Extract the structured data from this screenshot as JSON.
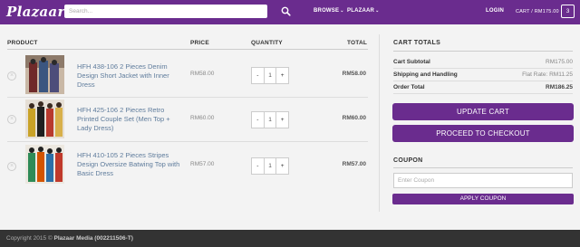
{
  "header": {
    "logo": "Plazaar",
    "search_placeholder": "Search...",
    "nav": [
      {
        "label": "BROWSE"
      },
      {
        "label": "PLAZAAR"
      }
    ],
    "login": "LOGIN",
    "cart_label": "CART / RM175.00",
    "cart_count": "3"
  },
  "table": {
    "headers": {
      "product": "PRODUCT",
      "price": "PRICE",
      "quantity": "QUANTITY",
      "total": "TOTAL"
    },
    "rows": [
      {
        "name": "HFH 438-106 2 Pieces Denim Design Short Jacket with Inner Dress",
        "price": "RM58.00",
        "qty": "1",
        "total": "RM58.00"
      },
      {
        "name": "HFH 425-106 2 Pieces Retro Printed Couple Set (Men Top + Lady Dress)",
        "price": "RM60.00",
        "qty": "1",
        "total": "RM60.00"
      },
      {
        "name": "HFH 410-105 2 Pieces Stripes Design Oversize Batwing Top with Basic Dress",
        "price": "RM57.00",
        "qty": "1",
        "total": "RM57.00"
      }
    ],
    "qty_minus": "-",
    "qty_plus": "+",
    "remove_symbol": "×"
  },
  "totals": {
    "title": "CART TOTALS",
    "subtotal_label": "Cart Subtotal",
    "subtotal_value": "RM175.00",
    "shipping_label": "Shipping and Handling",
    "shipping_value": "Flat Rate: RM11.25",
    "order_label": "Order Total",
    "order_value": "RM186.25",
    "update_button": "UPDATE CART",
    "checkout_button": "PROCEED TO CHECKOUT"
  },
  "coupon": {
    "title": "COUPON",
    "placeholder": "Enter Coupon",
    "apply_button": "APPLY COUPON"
  },
  "footer": {
    "prefix": "Copyright 2015 ©",
    "company": "Plazaar Media (002211506-T)"
  },
  "colors": {
    "brand": "#6a2c8e",
    "footer": "#333333",
    "link": "#5f7c9c"
  }
}
